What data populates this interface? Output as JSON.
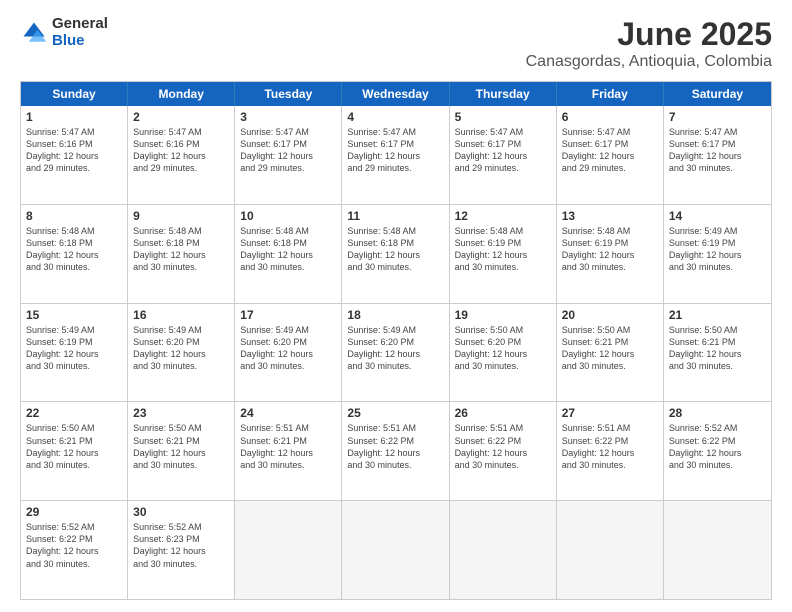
{
  "logo": {
    "general": "General",
    "blue": "Blue"
  },
  "title": "June 2025",
  "subtitle": "Canasgordas, Antioquia, Colombia",
  "days": [
    "Sunday",
    "Monday",
    "Tuesday",
    "Wednesday",
    "Thursday",
    "Friday",
    "Saturday"
  ],
  "rows": [
    [
      {
        "day": "1",
        "text": "Sunrise: 5:47 AM\nSunset: 6:16 PM\nDaylight: 12 hours\nand 29 minutes."
      },
      {
        "day": "2",
        "text": "Sunrise: 5:47 AM\nSunset: 6:16 PM\nDaylight: 12 hours\nand 29 minutes."
      },
      {
        "day": "3",
        "text": "Sunrise: 5:47 AM\nSunset: 6:17 PM\nDaylight: 12 hours\nand 29 minutes."
      },
      {
        "day": "4",
        "text": "Sunrise: 5:47 AM\nSunset: 6:17 PM\nDaylight: 12 hours\nand 29 minutes."
      },
      {
        "day": "5",
        "text": "Sunrise: 5:47 AM\nSunset: 6:17 PM\nDaylight: 12 hours\nand 29 minutes."
      },
      {
        "day": "6",
        "text": "Sunrise: 5:47 AM\nSunset: 6:17 PM\nDaylight: 12 hours\nand 29 minutes."
      },
      {
        "day": "7",
        "text": "Sunrise: 5:47 AM\nSunset: 6:17 PM\nDaylight: 12 hours\nand 30 minutes."
      }
    ],
    [
      {
        "day": "8",
        "text": "Sunrise: 5:48 AM\nSunset: 6:18 PM\nDaylight: 12 hours\nand 30 minutes."
      },
      {
        "day": "9",
        "text": "Sunrise: 5:48 AM\nSunset: 6:18 PM\nDaylight: 12 hours\nand 30 minutes."
      },
      {
        "day": "10",
        "text": "Sunrise: 5:48 AM\nSunset: 6:18 PM\nDaylight: 12 hours\nand 30 minutes."
      },
      {
        "day": "11",
        "text": "Sunrise: 5:48 AM\nSunset: 6:18 PM\nDaylight: 12 hours\nand 30 minutes."
      },
      {
        "day": "12",
        "text": "Sunrise: 5:48 AM\nSunset: 6:19 PM\nDaylight: 12 hours\nand 30 minutes."
      },
      {
        "day": "13",
        "text": "Sunrise: 5:48 AM\nSunset: 6:19 PM\nDaylight: 12 hours\nand 30 minutes."
      },
      {
        "day": "14",
        "text": "Sunrise: 5:49 AM\nSunset: 6:19 PM\nDaylight: 12 hours\nand 30 minutes."
      }
    ],
    [
      {
        "day": "15",
        "text": "Sunrise: 5:49 AM\nSunset: 6:19 PM\nDaylight: 12 hours\nand 30 minutes."
      },
      {
        "day": "16",
        "text": "Sunrise: 5:49 AM\nSunset: 6:20 PM\nDaylight: 12 hours\nand 30 minutes."
      },
      {
        "day": "17",
        "text": "Sunrise: 5:49 AM\nSunset: 6:20 PM\nDaylight: 12 hours\nand 30 minutes."
      },
      {
        "day": "18",
        "text": "Sunrise: 5:49 AM\nSunset: 6:20 PM\nDaylight: 12 hours\nand 30 minutes."
      },
      {
        "day": "19",
        "text": "Sunrise: 5:50 AM\nSunset: 6:20 PM\nDaylight: 12 hours\nand 30 minutes."
      },
      {
        "day": "20",
        "text": "Sunrise: 5:50 AM\nSunset: 6:21 PM\nDaylight: 12 hours\nand 30 minutes."
      },
      {
        "day": "21",
        "text": "Sunrise: 5:50 AM\nSunset: 6:21 PM\nDaylight: 12 hours\nand 30 minutes."
      }
    ],
    [
      {
        "day": "22",
        "text": "Sunrise: 5:50 AM\nSunset: 6:21 PM\nDaylight: 12 hours\nand 30 minutes."
      },
      {
        "day": "23",
        "text": "Sunrise: 5:50 AM\nSunset: 6:21 PM\nDaylight: 12 hours\nand 30 minutes."
      },
      {
        "day": "24",
        "text": "Sunrise: 5:51 AM\nSunset: 6:21 PM\nDaylight: 12 hours\nand 30 minutes."
      },
      {
        "day": "25",
        "text": "Sunrise: 5:51 AM\nSunset: 6:22 PM\nDaylight: 12 hours\nand 30 minutes."
      },
      {
        "day": "26",
        "text": "Sunrise: 5:51 AM\nSunset: 6:22 PM\nDaylight: 12 hours\nand 30 minutes."
      },
      {
        "day": "27",
        "text": "Sunrise: 5:51 AM\nSunset: 6:22 PM\nDaylight: 12 hours\nand 30 minutes."
      },
      {
        "day": "28",
        "text": "Sunrise: 5:52 AM\nSunset: 6:22 PM\nDaylight: 12 hours\nand 30 minutes."
      }
    ],
    [
      {
        "day": "29",
        "text": "Sunrise: 5:52 AM\nSunset: 6:22 PM\nDaylight: 12 hours\nand 30 minutes."
      },
      {
        "day": "30",
        "text": "Sunrise: 5:52 AM\nSunset: 6:23 PM\nDaylight: 12 hours\nand 30 minutes."
      },
      {
        "day": "",
        "text": "",
        "empty": true
      },
      {
        "day": "",
        "text": "",
        "empty": true
      },
      {
        "day": "",
        "text": "",
        "empty": true
      },
      {
        "day": "",
        "text": "",
        "empty": true
      },
      {
        "day": "",
        "text": "",
        "empty": true
      }
    ]
  ]
}
